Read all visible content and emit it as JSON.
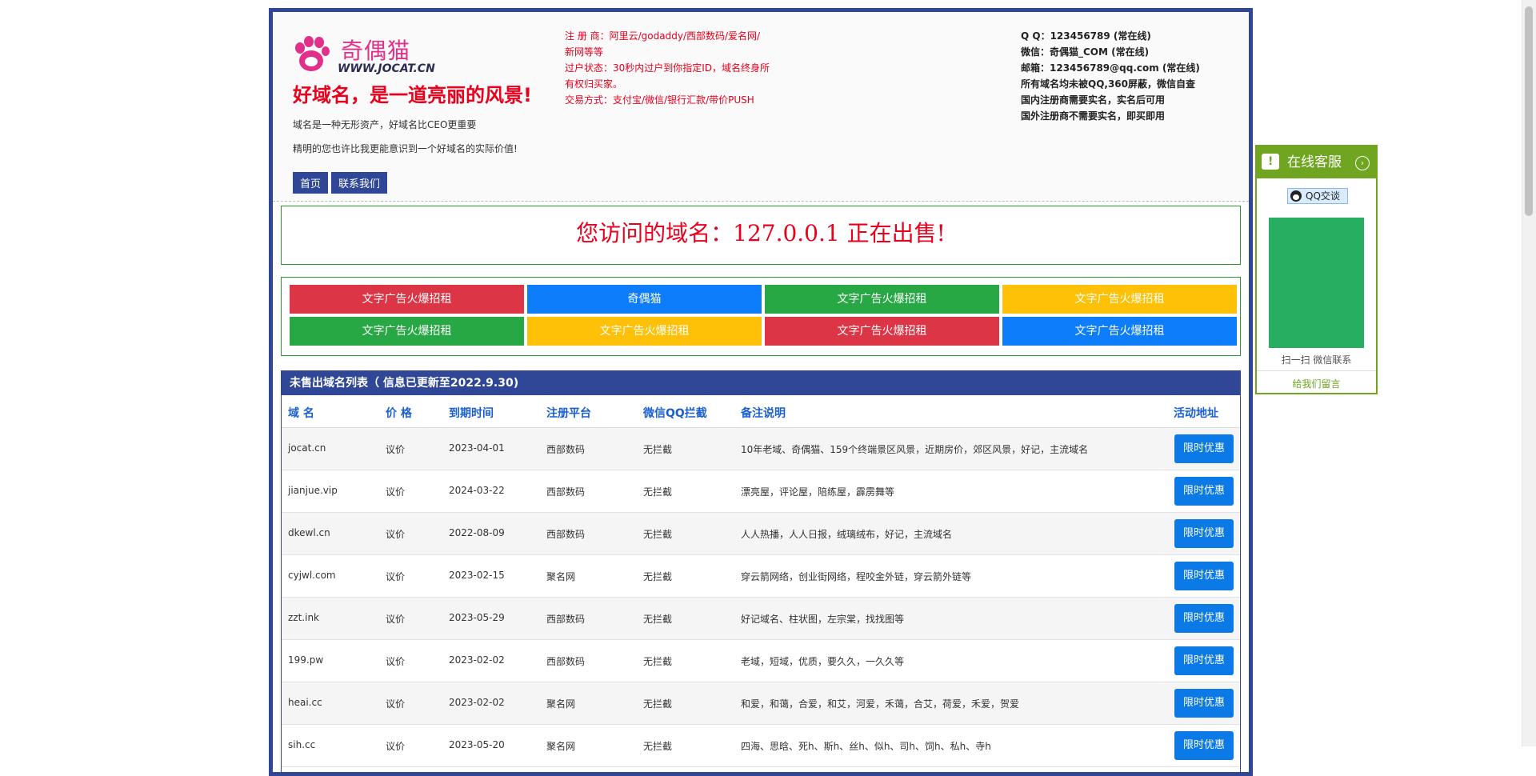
{
  "header": {
    "logo_name": "奇偶猫",
    "logo_url": "WWW.JOCAT.CN",
    "slogan": "好域名，是一道亮丽的风景!",
    "desc1": "域名是一种无形资产，好域名比CEO更重要",
    "desc2": "精明的您也许比我更能意识到一个好域名的实际价值!",
    "nav": [
      {
        "label": "首页"
      },
      {
        "label": "联系我们"
      }
    ],
    "mid_info": [
      "注 册 商：阿里云/godaddy/西部数码/爱名网/",
      "新网等等",
      "过户状态：30秒内过户到你指定ID，域名终身所",
      "有权归买家。",
      "交易方式：支付宝/微信/银行汇款/带价PUSH"
    ],
    "right_info": [
      "Q Q：123456789 (常在线)",
      "微信：奇偶猫_COM (常在线)",
      "邮箱：123456789@qq.com (常在线)",
      "所有域名均未被QQ,360屏蔽，微信自查",
      "国内注册商需要实名，实名后可用",
      "国外注册商不需要实名，即买即用"
    ]
  },
  "sale": {
    "text": "您访问的域名：127.0.0.1 正在出售!"
  },
  "ads": [
    {
      "label": "文字广告火爆招租",
      "color": "#dc3545"
    },
    {
      "label": "奇偶猫",
      "color": "#0d7dfc"
    },
    {
      "label": "文字广告火爆招租",
      "color": "#28a745"
    },
    {
      "label": "文字广告火爆招租",
      "color": "#ffc107"
    },
    {
      "label": "文字广告火爆招租",
      "color": "#28a745"
    },
    {
      "label": "文字广告火爆招租",
      "color": "#ffc107"
    },
    {
      "label": "文字广告火爆招租",
      "color": "#dc3545"
    },
    {
      "label": "文字广告火爆招租",
      "color": "#0d7dfc"
    }
  ],
  "list": {
    "title": "未售出域名列表（ 信息已更新至2022.9.30)",
    "columns": {
      "domain": "域 名",
      "price": "价 格",
      "expire": "到期时间",
      "registrar": "注册平台",
      "block": "微信QQ拦截",
      "note": "备注说明",
      "action": "活动地址"
    },
    "rows": [
      {
        "domain": "jocat.cn",
        "price": "议价",
        "expire": "2023-04-01",
        "registrar": "西部数码",
        "block": "无拦截",
        "note": "10年老域、奇偶猫、159个终端景区风景，近期房价，郊区风景，好记，主流域名",
        "action": "限时优惠"
      },
      {
        "domain": "jianjue.vip",
        "price": "议价",
        "expire": "2024-03-22",
        "registrar": "西部数码",
        "block": "无拦截",
        "note": "漂亮屋，评论屋，陪练屋，霹雳舞等",
        "action": "限时优惠"
      },
      {
        "domain": "dkewl.cn",
        "price": "议价",
        "expire": "2022-08-09",
        "registrar": "西部数码",
        "block": "无拦截",
        "note": "人人热播，人人日报，绒璃绒布，好记，主流域名",
        "action": "限时优惠"
      },
      {
        "domain": "cyjwl.com",
        "price": "议价",
        "expire": "2023-02-15",
        "registrar": "聚名网",
        "block": "无拦截",
        "note": "穿云箭网络，创业街网络，程咬金外链，穿云箭外链等",
        "action": "限时优惠"
      },
      {
        "domain": "zzt.ink",
        "price": "议价",
        "expire": "2023-05-29",
        "registrar": "西部数码",
        "block": "无拦截",
        "note": "好记域名、柱状图，左宗棠，找找图等",
        "action": "限时优惠"
      },
      {
        "domain": "199.pw",
        "price": "议价",
        "expire": "2023-02-02",
        "registrar": "西部数码",
        "block": "无拦截",
        "note": "老域，短域，优质，要久久，一久久等",
        "action": "限时优惠"
      },
      {
        "domain": "heai.cc",
        "price": "议价",
        "expire": "2023-02-02",
        "registrar": "聚名网",
        "block": "无拦截",
        "note": "和爱，和蔼，合爱，和艾，河爱，禾蔼，合艾，荷爱，禾爱，贺爱",
        "action": "限时优惠"
      },
      {
        "domain": "sih.cc",
        "price": "议价",
        "expire": "2023-05-20",
        "registrar": "聚名网",
        "block": "无拦截",
        "note": "四海、思晗、死h、斯h、丝h、似h、司h、饲h、私h、寺h",
        "action": "限时优惠"
      }
    ]
  },
  "customer_service": {
    "title": "在线客服",
    "qq_label": "QQ交谈",
    "scan_text": "扫一扫 微信联系",
    "leave_msg": "给我们留言"
  }
}
